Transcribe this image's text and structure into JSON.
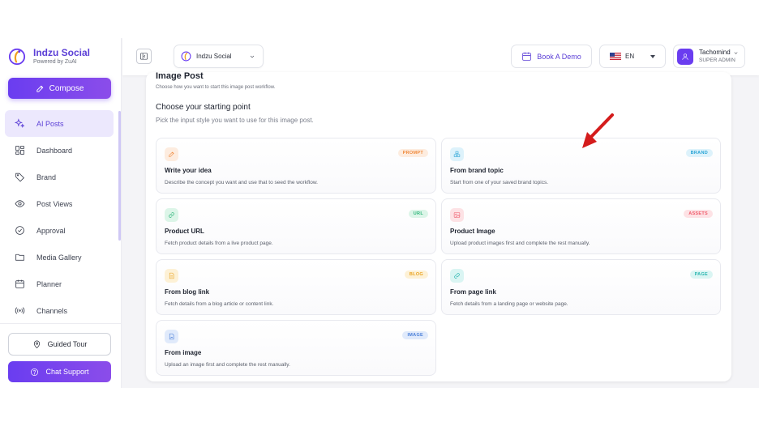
{
  "app": {
    "name": "Indzu Social",
    "tagline": "Powered by ZuAI"
  },
  "sidebar": {
    "compose_label": "Compose",
    "items": [
      {
        "label": "AI Posts",
        "icon": "sparkle-icon",
        "active": true
      },
      {
        "label": "Dashboard",
        "icon": "grid-icon",
        "active": false
      },
      {
        "label": "Brand",
        "icon": "tag-icon",
        "active": false
      },
      {
        "label": "Post Views",
        "icon": "eye-icon",
        "active": false
      },
      {
        "label": "Approval",
        "icon": "check-circle-icon",
        "active": false
      },
      {
        "label": "Media Gallery",
        "icon": "folder-icon",
        "active": false
      },
      {
        "label": "Planner",
        "icon": "calendar-icon",
        "active": false
      },
      {
        "label": "Channels",
        "icon": "broadcast-icon",
        "active": false
      }
    ],
    "guided_tour_label": "Guided Tour",
    "chat_support_label": "Chat Support"
  },
  "header": {
    "workspace": "Indzu Social",
    "book_demo": "Book A Demo",
    "language": "EN",
    "user_name": "Tachomind",
    "user_role": "SUPER ADMIN"
  },
  "main": {
    "title": "Image Post",
    "subtitle": "Choose how you want to start this image post workflow.",
    "section_title": "Choose your starting point",
    "section_subtitle": "Pick the input style you want to use for this image post.",
    "options": [
      {
        "title": "Write your idea",
        "desc": "Describe the concept you want and use that to seed the workflow.",
        "tag": "PROMPT",
        "icon": "edit-icon",
        "color": "#f08a3c",
        "tag_bg": "#fdecdf"
      },
      {
        "title": "From brand topic",
        "desc": "Start from one of your saved brand topics.",
        "tag": "BRAND",
        "icon": "cubes-icon",
        "color": "#2aa5d6",
        "tag_bg": "#ddf2fb"
      },
      {
        "title": "Product URL",
        "desc": "Fetch product details from a live product page.",
        "tag": "URL",
        "icon": "link-icon",
        "color": "#2fb57a",
        "tag_bg": "#dcf5e8"
      },
      {
        "title": "Product Image",
        "desc": "Upload product images first and complete the rest manually.",
        "tag": "ASSETS",
        "icon": "image-icon",
        "color": "#ef5a6a",
        "tag_bg": "#fde2e5"
      },
      {
        "title": "From blog link",
        "desc": "Fetch details from a blog article or content link.",
        "tag": "BLOG",
        "icon": "document-icon",
        "color": "#e9a320",
        "tag_bg": "#fdf1d6"
      },
      {
        "title": "From page link",
        "desc": "Fetch details from a landing page or website page.",
        "tag": "PAGE",
        "icon": "link-icon",
        "color": "#2bb6b0",
        "tag_bg": "#daf5f3"
      },
      {
        "title": "From image",
        "desc": "Upload an image first and complete the rest manually.",
        "tag": "IMAGE",
        "icon": "file-image-icon",
        "color": "#4a7fd8",
        "tag_bg": "#e0eafb"
      }
    ]
  },
  "colors": {
    "accent": "#6a3df0",
    "annotation_arrow": "#d41c1c"
  }
}
